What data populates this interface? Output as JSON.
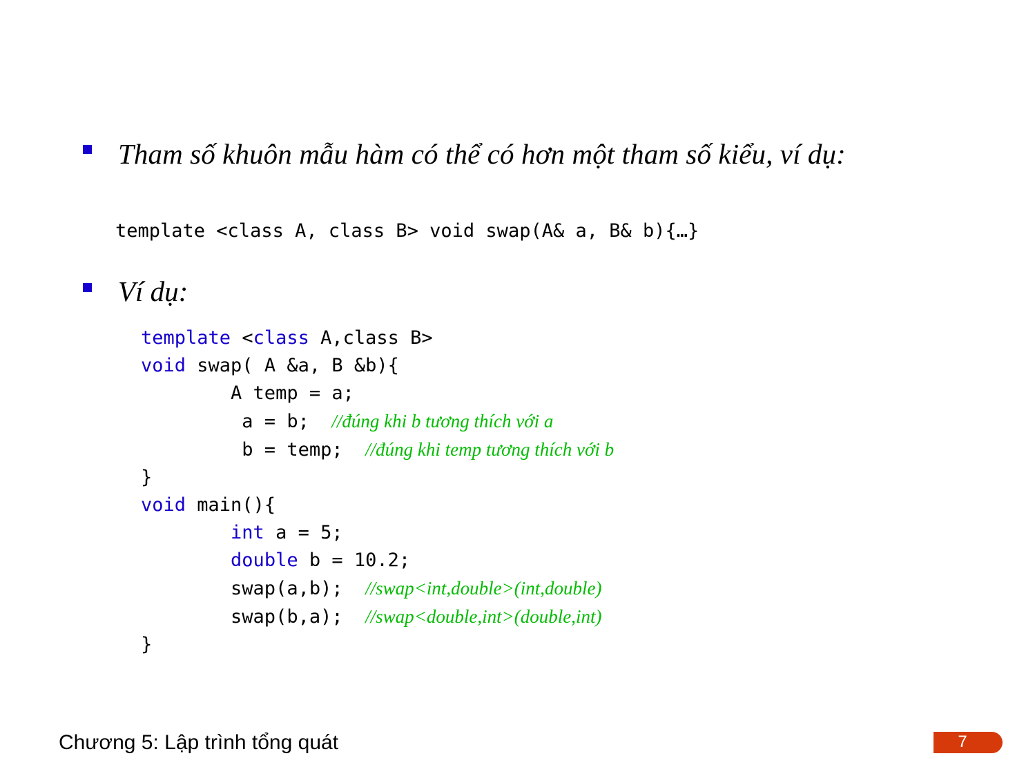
{
  "slide": {
    "background_color": "#ffffff",
    "bullet_color": "#1500D1",
    "keyword_color": "#1500CC",
    "comment_color": "#00BB00",
    "badge_color": "#D63A0B"
  },
  "bullets": [
    {
      "marker": "square-bullet",
      "text": "Tham số khuôn mẫu hàm có thể có hơn một tham số kiểu, ví dụ:"
    },
    {
      "marker": "square-bullet",
      "text": "Ví dụ:"
    }
  ],
  "inline_code": {
    "text": "template <class A, class B> void swap(A& a, B& b){…}"
  },
  "code_block": {
    "lines": [
      [
        {
          "t": "template ",
          "s": "kw"
        },
        {
          "t": "<",
          "s": "plain"
        },
        {
          "t": "class",
          "s": "kw"
        },
        {
          "t": " A,class B>",
          "s": "plain"
        }
      ],
      [
        {
          "t": "void",
          "s": "kw"
        },
        {
          "t": " swap( A &a, B &b){",
          "s": "plain"
        }
      ],
      [
        {
          "t": "        A temp = a;",
          "s": "plain"
        }
      ],
      [
        {
          "t": "         a = b;  ",
          "s": "plain"
        },
        {
          "t": "//đúng khi b tương thích với a",
          "s": "cmt"
        }
      ],
      [
        {
          "t": "         b = temp;  ",
          "s": "plain"
        },
        {
          "t": "//đúng khi temp tương thích với b",
          "s": "cmt"
        }
      ],
      [
        {
          "t": "}",
          "s": "plain"
        }
      ],
      [
        {
          "t": "void",
          "s": "kw"
        },
        {
          "t": " main(){",
          "s": "plain"
        }
      ],
      [
        {
          "t": "        ",
          "s": "plain"
        },
        {
          "t": "int",
          "s": "kw"
        },
        {
          "t": " a = 5;",
          "s": "plain"
        }
      ],
      [
        {
          "t": "        ",
          "s": "plain"
        },
        {
          "t": "double",
          "s": "kw"
        },
        {
          "t": " b = 10.2;",
          "s": "plain"
        }
      ],
      [
        {
          "t": "        swap(a,b);  ",
          "s": "plain"
        },
        {
          "t": "//swap<int,double>(int,double)",
          "s": "cmt"
        }
      ],
      [
        {
          "t": "        swap(b,a);  ",
          "s": "plain"
        },
        {
          "t": "//swap<double,int>(double,int)",
          "s": "cmt"
        }
      ],
      [
        {
          "t": "}",
          "s": "plain"
        }
      ]
    ]
  },
  "footer": {
    "title": "Chương 5: Lập trình tổng quát",
    "page_number": "7"
  }
}
